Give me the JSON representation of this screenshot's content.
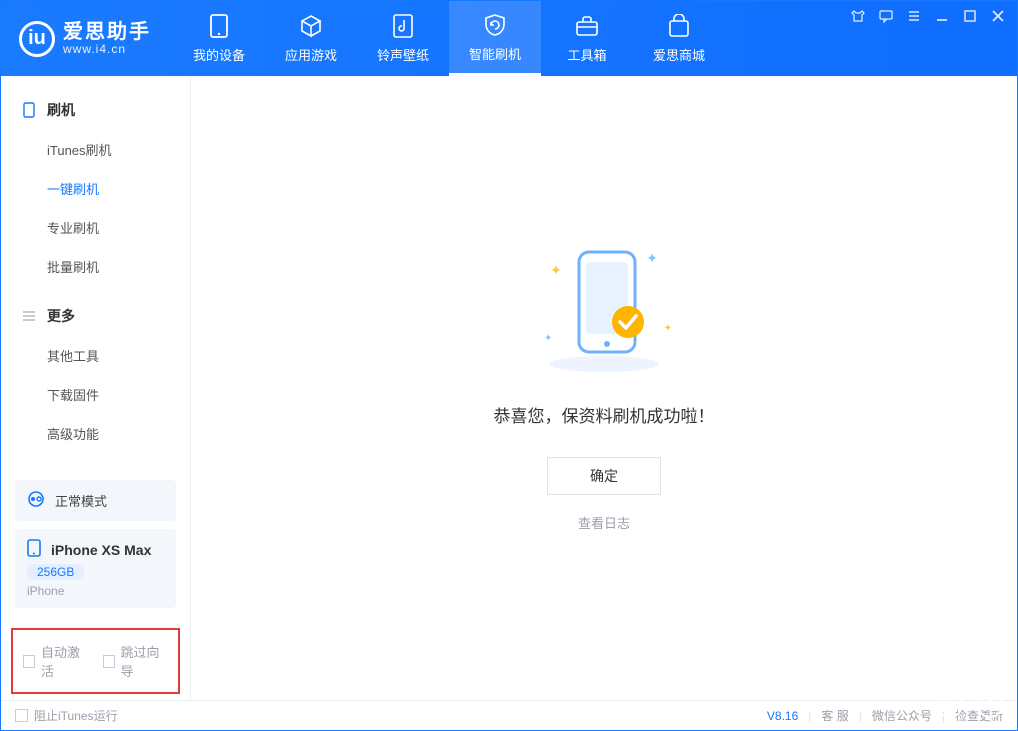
{
  "header": {
    "logo_cn": "爱思助手",
    "logo_url": "www.i4.cn",
    "nav": [
      {
        "id": "my-device",
        "label": "我的设备",
        "active": false
      },
      {
        "id": "apps",
        "label": "应用游戏",
        "active": false
      },
      {
        "id": "ringtones",
        "label": "铃声壁纸",
        "active": false
      },
      {
        "id": "flash",
        "label": "智能刷机",
        "active": true
      },
      {
        "id": "toolbox",
        "label": "工具箱",
        "active": false
      },
      {
        "id": "store",
        "label": "爱思商城",
        "active": false
      }
    ]
  },
  "sidebar": {
    "cat_flash": "刷机",
    "cat_more": "更多",
    "flash_items": [
      {
        "id": "itunes",
        "label": "iTunes刷机"
      },
      {
        "id": "oneclick",
        "label": "一键刷机",
        "active": true
      },
      {
        "id": "pro",
        "label": "专业刷机"
      },
      {
        "id": "batch",
        "label": "批量刷机"
      }
    ],
    "more_items": [
      {
        "id": "other",
        "label": "其他工具"
      },
      {
        "id": "firmware",
        "label": "下载固件"
      },
      {
        "id": "advanced",
        "label": "高级功能"
      }
    ],
    "mode_label": "正常模式",
    "device_name": "iPhone XS Max",
    "device_capacity": "256GB",
    "device_type": "iPhone",
    "auto_activate": "自动激活",
    "skip_guide": "跳过向导"
  },
  "main": {
    "success_msg": "恭喜您，保资料刷机成功啦！",
    "ok": "确定",
    "view_log": "查看日志"
  },
  "footer": {
    "block_itunes": "阻止iTunes运行",
    "version": "V8.16",
    "support": "客 服",
    "wechat": "微信公众号",
    "update": "检查更新"
  }
}
